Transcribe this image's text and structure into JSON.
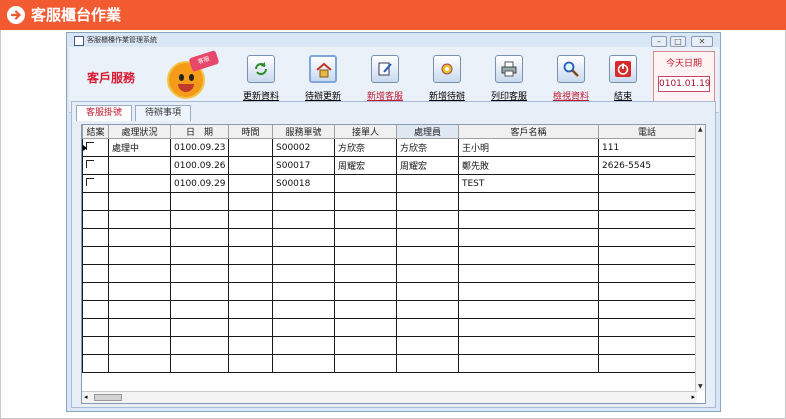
{
  "banner": {
    "title": "客服櫃台作業",
    "icon": "arrow-right-circle-icon",
    "color": "#f25a32"
  },
  "window": {
    "title": "客服櫃檯作業管理系統",
    "min": "–",
    "max": "□",
    "close": "✕"
  },
  "logo": {
    "text": "客戶服務",
    "tag": "客服"
  },
  "toolbar": {
    "buttons": [
      {
        "label": "更新資料",
        "icon": "refresh-icon"
      },
      {
        "label": "待辦更新",
        "icon": "home-icon"
      },
      {
        "label": "新增客服",
        "icon": "edit-icon"
      },
      {
        "label": "新增待辦",
        "icon": "gear-icon"
      },
      {
        "label": "列印客服",
        "icon": "printer-icon"
      },
      {
        "label": "檢視資料",
        "icon": "search-icon"
      },
      {
        "label": "結束",
        "icon": "power-icon"
      }
    ]
  },
  "today": {
    "label": "今天日期",
    "value": "0101.01.19"
  },
  "tabs": [
    {
      "label": "客服掛號"
    },
    {
      "label": "待辦事項"
    }
  ],
  "table": {
    "headers": [
      "結案",
      "處理狀況",
      "日　期",
      "時間",
      "服務單號",
      "接單人",
      "處理員",
      "客戶名稱",
      "電話"
    ],
    "rows": [
      [
        "",
        "處理中",
        "0100.09.23",
        "",
        "S00002",
        "方欣奈",
        "方欣奈",
        "王小明",
        "111"
      ],
      [
        "",
        "",
        "0100.09.26",
        "",
        "S00017",
        "周耀宏",
        "周耀宏",
        "鄭先敗",
        "2626-5545"
      ],
      [
        "",
        "",
        "0100.09.29",
        "",
        "S00018",
        "",
        "",
        "TEST",
        ""
      ]
    ]
  }
}
